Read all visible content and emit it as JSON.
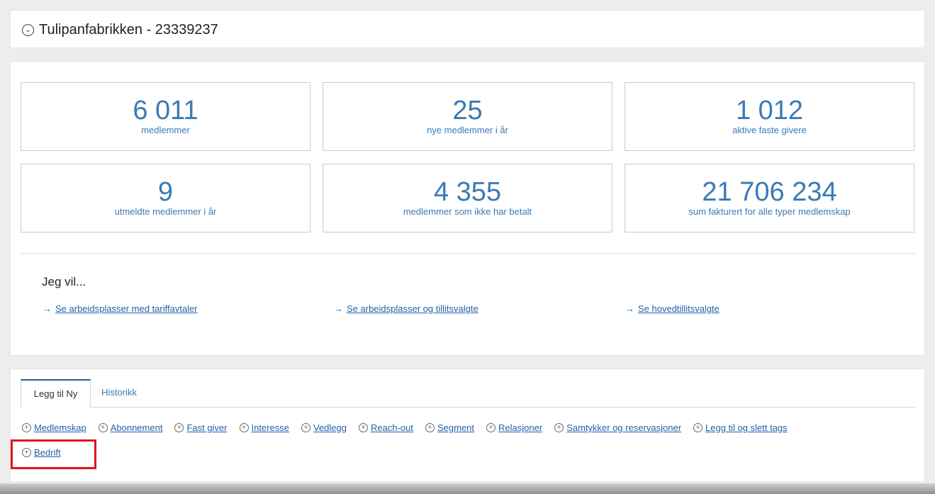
{
  "header": {
    "title": "Tulipanfabrikken - 23339237"
  },
  "stats": [
    {
      "value": "6 011",
      "label": "medlemmer"
    },
    {
      "value": "25",
      "label": "nye medlemmer i år"
    },
    {
      "value": "1 012",
      "label": "aktive faste givere"
    },
    {
      "value": "9",
      "label": "utmeldte medlemmer i år"
    },
    {
      "value": "4 355",
      "label": "medlemmer som ikke har betalt"
    },
    {
      "value": "21 706 234",
      "label": "sum fakturert for alle typer medlemskap"
    }
  ],
  "jeg_vil": {
    "heading": "Jeg vil...",
    "links": [
      "Se arbeidsplasser med tariffavtaler",
      "Se arbeidsplasser og tillitsvalgte",
      "Se hovedtillitsvalgte"
    ]
  },
  "tabs": [
    {
      "label": "Legg til Ny",
      "active": true
    },
    {
      "label": "Historikk",
      "active": false
    }
  ],
  "add_items": [
    "Medlemskap",
    "Abonnement",
    "Fast giver",
    "Interesse",
    "Vedlegg",
    "Reach-out",
    "Segment",
    "Relasjoner",
    "Samtykker og reservasjoner",
    "Legg til og slett tags",
    "Bedrift"
  ],
  "colors": {
    "accent": "#3a7ab5",
    "link": "#1f63a8",
    "highlight": "#e0141e"
  },
  "icons": {
    "collapse": "chevron-down-circle-icon",
    "add": "plus-circle-icon",
    "arrow": "arrow-right-icon"
  }
}
